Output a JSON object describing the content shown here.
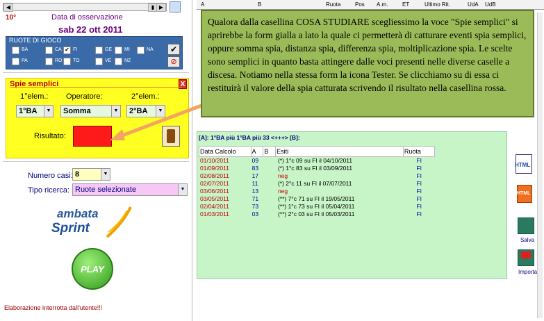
{
  "left": {
    "wheel_number": "10°",
    "date_title": "Data di osservazione",
    "date_value": "sab 22 ott 2011",
    "ruote_title": "RUOTE DI GIOCO",
    "ruote": [
      "BA",
      "CA",
      "FI",
      "GE",
      "MI",
      "NA",
      "PA",
      "RO",
      "TO",
      "VE",
      "NZ"
    ],
    "ruote_checked": [
      "FI"
    ],
    "spie": {
      "title": "Spie semplici",
      "close": "X",
      "elem1_label": "1°elem.:",
      "oper_label": "Operatore:",
      "elem2_label": "2°elem.:",
      "elem1_value": "1°BA",
      "oper_value": "Somma",
      "elem2_value": "2°BA",
      "result_label": "Risultato:"
    },
    "numero_casi_label": "Numero casi:",
    "numero_casi_value": "8",
    "tipo_ricerca_label": "Tipo ricerca:",
    "tipo_ricerca_value": "Ruote selezionate",
    "logo_line1": "ambata",
    "logo_line2": "Sprint",
    "play_label": "PLAY",
    "status_text": "Elaborazione interrotta dall'utente!!!"
  },
  "grid_header": [
    "A",
    "B",
    "Ruota",
    "Pos",
    "A.m.",
    "ET",
    "Ultimo Rit.",
    "UdA",
    "UdB"
  ],
  "note_text": "Qualora dalla casellina COSA STUDIARE scegliessimo la voce \"Spie semplici\" si aprirebbe la form gialla a lato la quale ci permetterà di catturare eventi spia semplici, oppure somma spia, distanza spia, differenza spia, moltiplicazione spia. Le scelte sono semplici in quanto basta attingere dalle voci presenti nelle diverse caselle a discesa. Notiamo nella stessa form la icona Tester. Se clicchiamo su di essa ci restituirà il valore della spia catturata scrivendo il risultato nella casellina rossa.",
  "results": {
    "summary": "[A]: 1°BA più  1°BA  più 33 <+++> [B]:",
    "headers": [
      "Data Calcolo",
      "A",
      "B",
      "Esiti",
      "Ruota"
    ],
    "rows": [
      {
        "date": "01/10/2011",
        "a": "09",
        "b": "",
        "esito": "(*) 1°c 09 su FI il 04/10/2011",
        "ruota": "FI"
      },
      {
        "date": "01/09/2011",
        "a": "83",
        "b": "",
        "esito": "(*) 1°c 83 su FI il 03/09/2011",
        "ruota": "FI"
      },
      {
        "date": "02/08/2011",
        "a": "17",
        "b": "",
        "esito": "neg",
        "ruota": "FI"
      },
      {
        "date": "02/07/2011",
        "a": "11",
        "b": "",
        "esito": "(*) 2°c 11 su FI il 07/07/2011",
        "ruota": "FI"
      },
      {
        "date": "03/06/2011",
        "a": "13",
        "b": "",
        "esito": "neg",
        "ruota": "FI"
      },
      {
        "date": "03/05/2011",
        "a": "71",
        "b": "",
        "esito": "(**) 7°c 71 su FI il 19/05/2011",
        "ruota": "FI"
      },
      {
        "date": "02/04/2011",
        "a": "73",
        "b": "",
        "esito": "(**) 1°c 73 su FI il 05/04/2011",
        "ruota": "FI"
      },
      {
        "date": "01/03/2011",
        "a": "03",
        "b": "",
        "esito": "(**) 2°c 03 su FI il 05/03/2011",
        "ruota": "FI"
      }
    ]
  },
  "side_icons": {
    "html1": "HTML",
    "html2": "HTML",
    "salva": "Salva",
    "importa": "Importa"
  }
}
